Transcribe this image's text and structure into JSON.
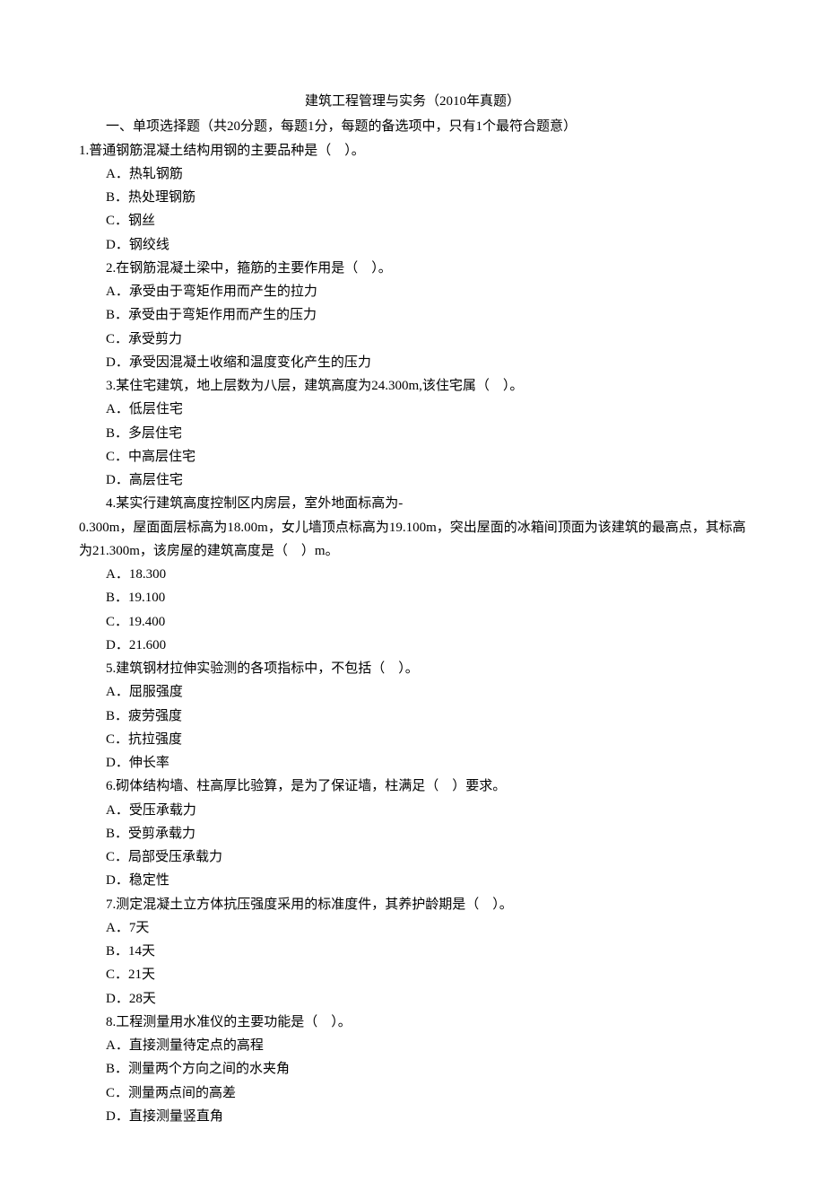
{
  "title": "建筑工程管理与实务（2010年真题）",
  "section_header": "一、单项选择题（共20分题，每题1分，每题的备选项中，只有1个最符合题意）",
  "q1": {
    "stem": "1.普通钢筋混凝土结构用钢的主要品种是（　）。",
    "a": "A．热轧钢筋",
    "b": "B．热处理钢筋",
    "c": "C．钢丝",
    "d": "D．钢绞线"
  },
  "q2": {
    "stem": "2.在钢筋混凝土梁中，箍筋的主要作用是（　）。",
    "a": "A．承受由于弯矩作用而产生的拉力",
    "b": "B．承受由于弯矩作用而产生的压力",
    "c": "C．承受剪力",
    "d": "D．承受因混凝土收缩和温度变化产生的压力"
  },
  "q3": {
    "stem": "3.某住宅建筑，地上层数为八层，建筑高度为24.300m,该住宅属（　）。",
    "a": "A．低层住宅",
    "b": "B．多层住宅",
    "c": "C．中高层住宅",
    "d": "D．高层住宅"
  },
  "q4": {
    "stem_l1": "4.某实行建筑高度控制区内房层，室外地面标高为-",
    "stem_l2": "0.300m，屋面面层标高为18.00m，女儿墙顶点标高为19.100m，突出屋面的冰箱间顶面为该建筑的最高点，其标高为21.300m，该房屋的建筑高度是（　）m。",
    "a": "A．18.300",
    "b": "B．19.100",
    "c": "C．19.400",
    "d": "D．21.600"
  },
  "q5": {
    "stem": "5.建筑钢材拉伸实验测的各项指标中，不包括（　）。",
    "a": "A．屈服强度",
    "b": "B．疲劳强度",
    "c": "C．抗拉强度",
    "d": "D．伸长率"
  },
  "q6": {
    "stem": "6.砌体结构墙、柱高厚比验算，是为了保证墙，柱满足（　）要求。",
    "a": "A．受压承载力",
    "b": "B．受剪承载力",
    "c": "C．局部受压承载力",
    "d": "D．稳定性"
  },
  "q7": {
    "stem": "7.测定混凝土立方体抗压强度采用的标准度件，其养护龄期是（　）。",
    "a": "A．7天",
    "b": "B．14天",
    "c": "C．21天",
    "d": "D．28天"
  },
  "q8": {
    "stem": "8.工程测量用水准仪的主要功能是（　）。",
    "a": "A．直接测量待定点的高程",
    "b": "B．测量两个方向之间的水夹角",
    "c": "C．测量两点间的高差",
    "d": "D．直接测量竖直角"
  }
}
